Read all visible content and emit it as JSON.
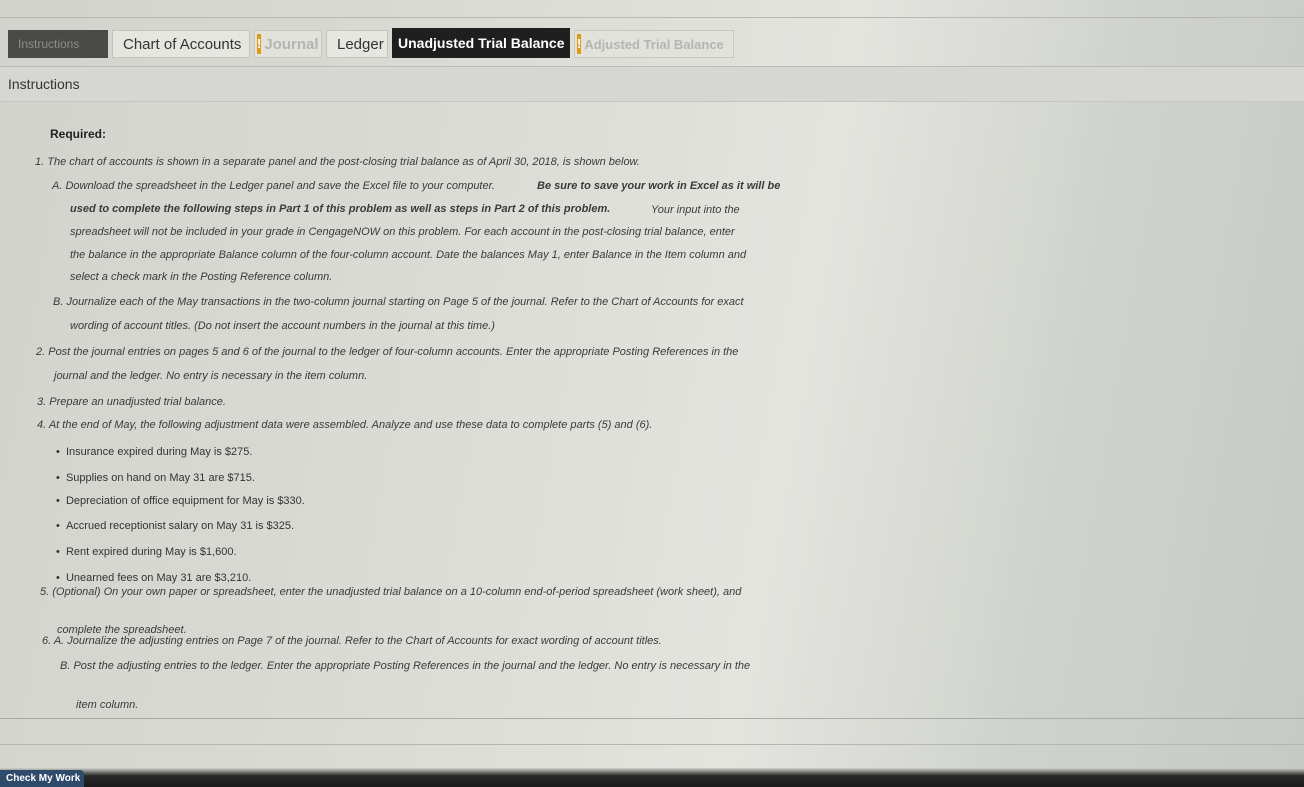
{
  "tabs": {
    "instructions": "Instructions",
    "chart_of_accounts": "Chart of Accounts",
    "journal": "Journal",
    "ledger": "Ledger",
    "unadjusted_trial_balance": "Unadjusted Trial Balance",
    "adjusted_trial_balance": "Adjusted Trial Balance"
  },
  "header": {
    "title": "Instructions"
  },
  "instructions": {
    "required": "Required:",
    "lines": [
      "1. The chart of accounts is shown in a separate panel and the post-closing trial balance as of April 30, 2018, is shown below.",
      "A. Download the spreadsheet in the Ledger panel and save the Excel file to your computer.",
      "Be sure to save your work in Excel as it will be",
      "used to complete the following steps in Part 1 of this problem as well as steps in Part 2 of this problem.",
      "Your input into the",
      "spreadsheet will not be included in your grade in CengageNOW on this problem. For each account in the post-closing trial balance, enter",
      "the balance in the appropriate Balance column of the four-column account. Date the balances May 1, enter Balance in the Item column and",
      "select a check mark in the Posting Reference column.",
      "B. Journalize each of the May transactions in the two-column journal starting on Page 5 of the journal. Refer to the Chart of Accounts for exact",
      "wording of account titles. (Do not insert the account numbers in the journal at this time.)",
      "2. Post the journal entries on pages 5 and 6 of the journal to the ledger of four-column accounts. Enter the appropriate Posting References in the",
      "journal and the ledger. No entry is necessary in the item column.",
      "3. Prepare an unadjusted trial balance.",
      "4. At the end of May, the following adjustment data were assembled. Analyze and use these data to complete parts (5) and (6).",
      "5. (Optional) On your own paper or spreadsheet, enter the unadjusted trial balance on a 10-column end-of-period spreadsheet (work sheet), and",
      "complete the spreadsheet.",
      "6. A. Journalize the adjusting entries on Page 7 of the journal. Refer to the Chart of Accounts for exact wording of account titles.",
      "B. Post the adjusting entries to the ledger. Enter the appropriate Posting References in the journal and the ledger. No entry is necessary in the",
      "item column."
    ],
    "bullets": [
      "Insurance expired during May is $275.",
      "Supplies on hand on May 31 are $715.",
      "Depreciation of office equipment for May is $330.",
      "Accrued receptionist salary on May 31 is $325.",
      "Rent expired during May is $1,600.",
      "Unearned fees on May 31 are $3,210."
    ]
  },
  "footer": {
    "check_button": "Check My Work"
  }
}
